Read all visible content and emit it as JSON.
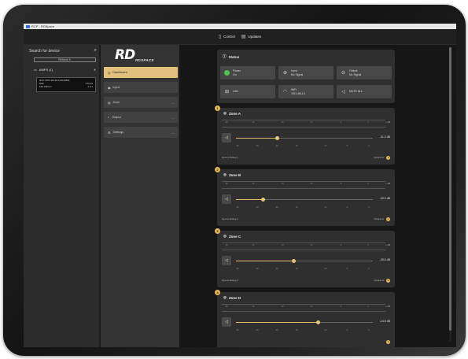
{
  "window_title": "RCP - RDSpace",
  "topbar": {
    "tabs": [
      {
        "label": "Control",
        "icon": "device-icon"
      },
      {
        "label": "Updates",
        "icon": "updates-icon"
      }
    ]
  },
  "device_panel": {
    "search_label": "Search for device",
    "refresh_label": "Refresh",
    "amps_label": "AMPS (1)",
    "amp": {
      "name": "RCP-XPD-1M-48-1040-8800",
      "model": "R&F",
      "ip": "192.168.0.1",
      "version": "V70.10",
      "extra": "1.0.1"
    }
  },
  "nav": {
    "logo": "RD",
    "logo_sub": "RDSPACE",
    "items": [
      {
        "label": "Dashboard",
        "icon": "dashboard-icon",
        "active": true
      },
      {
        "label": "Input",
        "icon": "input-icon",
        "active": false
      },
      {
        "label": "Zone",
        "icon": "zone-icon",
        "active": false,
        "chevron": true
      },
      {
        "label": "Output",
        "icon": "output-icon",
        "active": false,
        "chevron": true
      },
      {
        "label": "Settings",
        "icon": "settings-icon",
        "active": false,
        "chevron": true
      }
    ]
  },
  "status": {
    "title": "Status",
    "tiles": [
      {
        "name": "power",
        "label": "Power",
        "value": "On"
      },
      {
        "name": "input",
        "label": "Input",
        "value": "No Signal"
      },
      {
        "name": "output",
        "label": "Output",
        "value": "No Signal"
      },
      {
        "name": "lan",
        "label": "LAN",
        "value": ""
      },
      {
        "name": "wifi",
        "label": "WiFi",
        "value": "192.168.4.1"
      },
      {
        "name": "mute-all",
        "label": "MUTE ALL",
        "value": ""
      }
    ]
  },
  "meter_ticks": [
    "-60",
    "-40",
    "-20",
    "-10",
    "-5",
    "0"
  ],
  "slider_ticks": [
    "-80",
    "-60",
    "-40",
    "-20",
    "-10",
    "-5",
    "0"
  ],
  "zones": [
    {
      "title": "Zone A",
      "level": 0.3,
      "value": "-31.2 dB",
      "source": "Input is Analog 1",
      "outputs_label": "Outputs to:",
      "badge": "1"
    },
    {
      "title": "Zone B",
      "level": 0.2,
      "value": "-40.0 dB",
      "source": "Input is Analog 2",
      "outputs_label": "Outputs to:",
      "badge": "2"
    },
    {
      "title": "Zone C",
      "level": 0.42,
      "value": "-25.6 dB",
      "source": "Input is Analog 3",
      "outputs_label": "Outputs to:",
      "badge": "3"
    },
    {
      "title": "Zone D",
      "level": 0.6,
      "value": "-14.6 dB",
      "source": "",
      "outputs_label": "",
      "badge": "4"
    }
  ],
  "meter_db_label": "-∞ dB",
  "colors": {
    "accent": "#e2c17f",
    "power_on": "#4ec34e",
    "panel": "#2f2f2f"
  }
}
